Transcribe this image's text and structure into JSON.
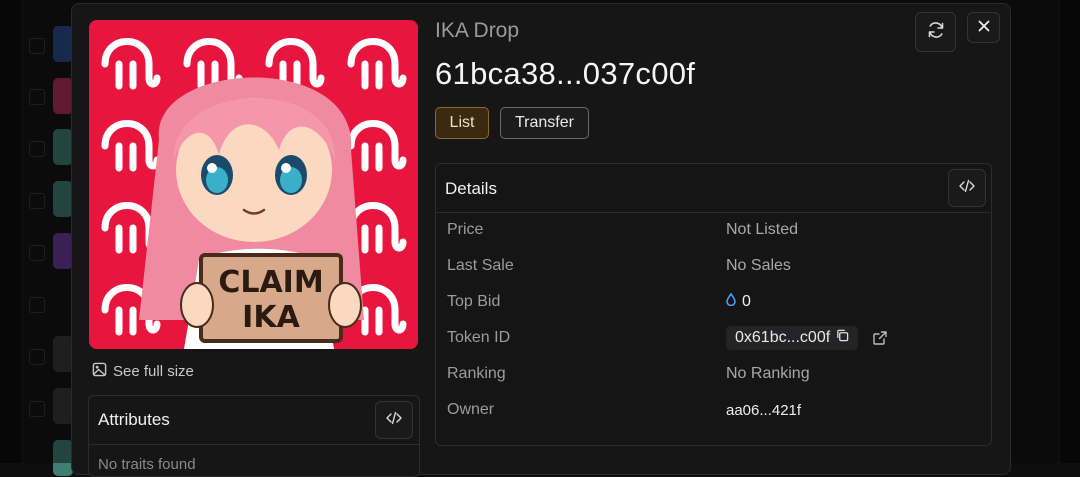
{
  "modal": {
    "collection": "IKA Drop",
    "nft_name": "61bca38...037c00f",
    "sign_text": "CLAIM IKA",
    "see_full_size": "See full size",
    "buttons": {
      "list": "List",
      "transfer": "Transfer"
    },
    "details": {
      "title": "Details",
      "rows": [
        {
          "label": "Price",
          "value": "Not Listed"
        },
        {
          "label": "Last Sale",
          "value": "No Sales"
        },
        {
          "label": "Top Bid",
          "value": "0"
        },
        {
          "label": "Token ID",
          "value": "0x61bc...c00f"
        },
        {
          "label": "Ranking",
          "value": "No Ranking"
        },
        {
          "label": "Owner",
          "value": "aa06...421f"
        }
      ]
    },
    "attributes": {
      "title": "Attributes",
      "empty": "No traits found"
    },
    "colors": {
      "accent": "#f2b24a",
      "image_bg": "#e8163f",
      "sui_drop": "#4da2ff"
    },
    "icons": [
      "refresh-icon",
      "close-icon",
      "code-icon",
      "image-icon",
      "droplet-icon",
      "copy-icon",
      "external-link-icon"
    ]
  }
}
